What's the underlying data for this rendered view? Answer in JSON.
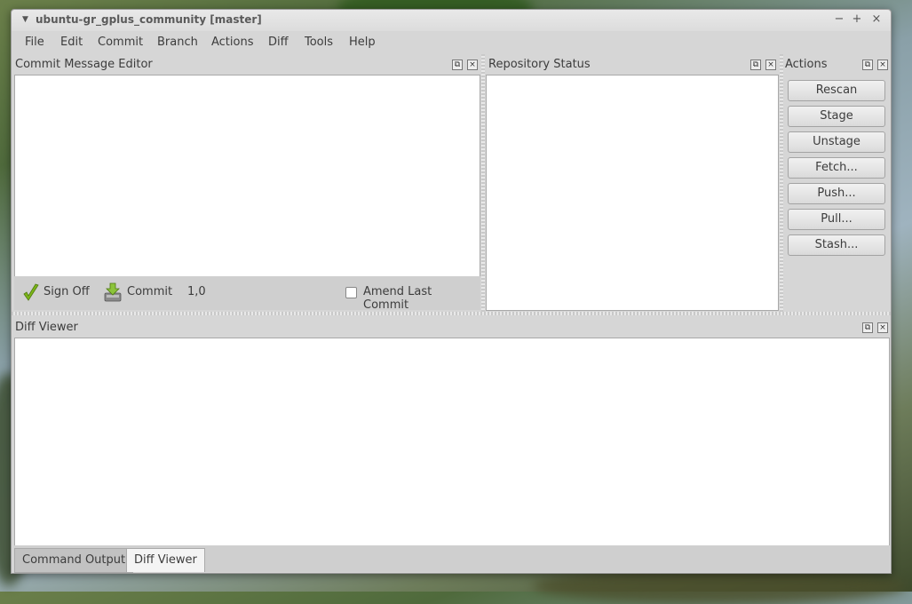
{
  "window": {
    "title": "ubuntu-gr_gplus_community [master]",
    "controls": {
      "minimize": "−",
      "maximize": "+",
      "close": "×"
    }
  },
  "menu": [
    "File",
    "Edit",
    "Commit",
    "Branch",
    "Actions",
    "Diff",
    "Tools",
    "Help"
  ],
  "commit_editor": {
    "title": "Commit Message Editor",
    "sign_off_label": "Sign Off",
    "commit_label": "Commit",
    "cursor_pos": "1,0",
    "amend_label": "Amend Last Commit",
    "amend_checked": false
  },
  "repo_status": {
    "title": "Repository Status"
  },
  "actions": {
    "title": "Actions",
    "buttons": [
      "Rescan",
      "Stage",
      "Unstage",
      "Fetch...",
      "Push...",
      "Pull...",
      "Stash..."
    ]
  },
  "diff_viewer": {
    "title": "Diff Viewer"
  },
  "bottom_tabs": [
    "Command Output",
    "Diff Viewer"
  ],
  "active_tab": "Diff Viewer",
  "colors": {
    "panel_bg": "#d6d6d6",
    "content_bg": "#ffffff",
    "check_green": "#7cb518"
  }
}
